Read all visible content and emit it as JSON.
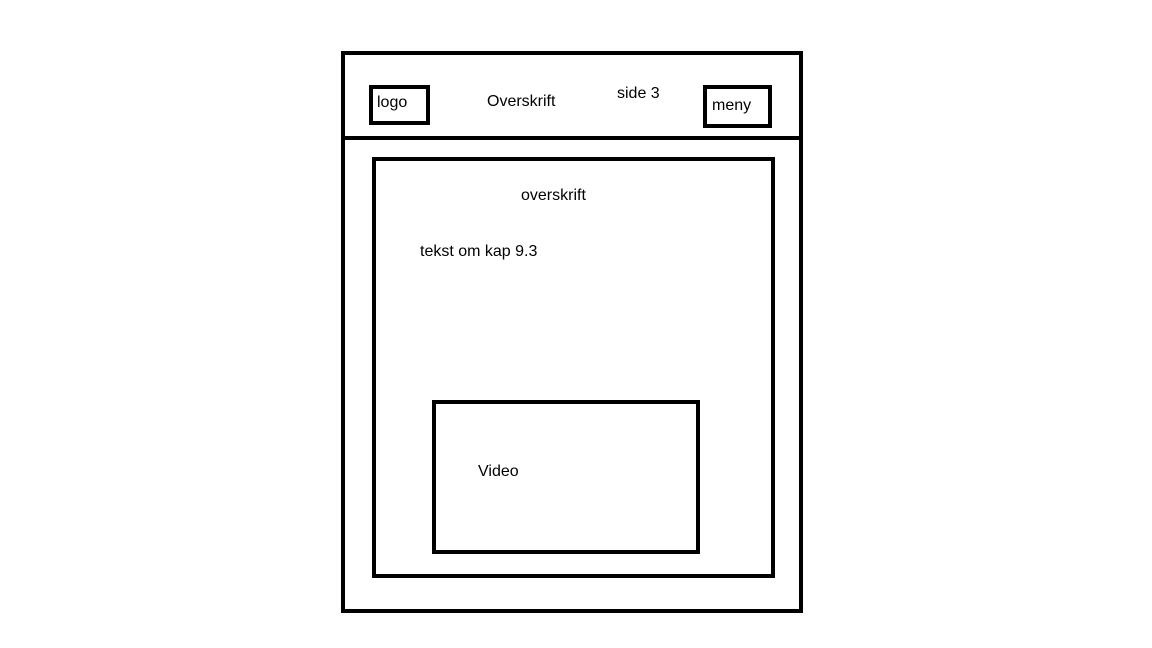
{
  "header": {
    "logo_label": "logo",
    "title": "Overskrift",
    "page_label": "side 3",
    "menu_label": "meny"
  },
  "content": {
    "heading": "overskrift",
    "body_text": "tekst om kap 9.3",
    "video_label": "Video"
  }
}
